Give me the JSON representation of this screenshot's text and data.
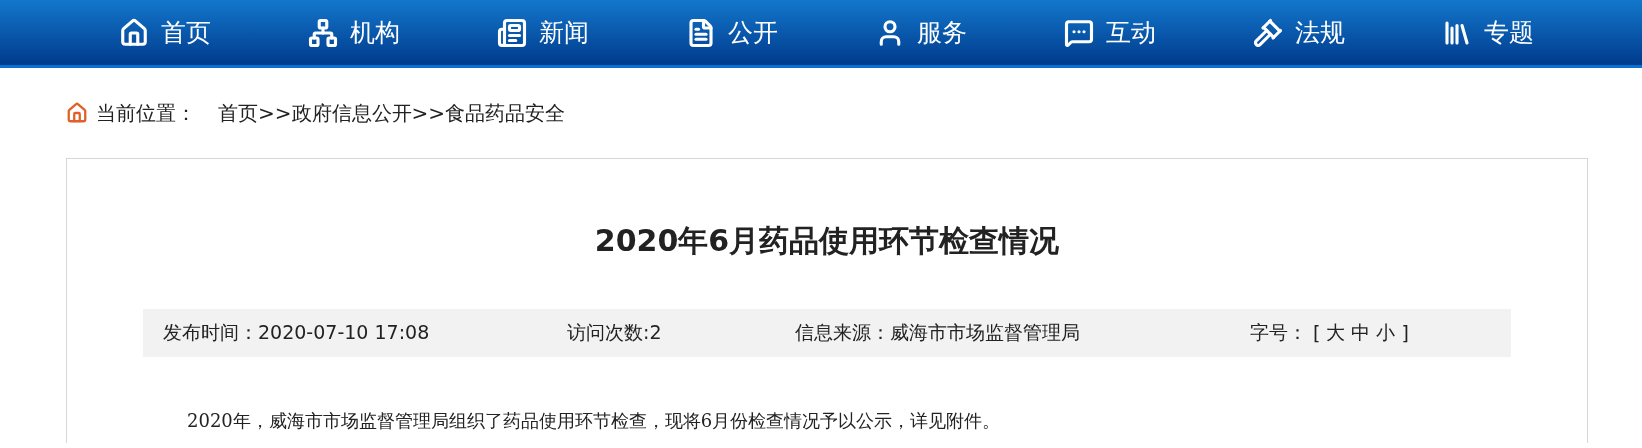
{
  "nav": [
    {
      "label": "首页"
    },
    {
      "label": "机构"
    },
    {
      "label": "新闻"
    },
    {
      "label": "公开"
    },
    {
      "label": "服务"
    },
    {
      "label": "互动"
    },
    {
      "label": "法规"
    },
    {
      "label": "专题"
    }
  ],
  "breadcrumb": {
    "label": "当前位置：",
    "items": [
      "首页",
      ">>",
      "政府信息公开",
      ">>",
      "食品药品安全"
    ]
  },
  "article": {
    "title": "2020年6月药品使用环节检查情况",
    "meta": {
      "published": "发布时间：2020-07-10 17:08",
      "visits": "访问次数:2",
      "source": "信息来源：威海市市场监督管理局",
      "font_size_label": "字号：",
      "font_size_options": [
        "[",
        "大",
        "中",
        "小",
        "]"
      ]
    },
    "body": "2020年，威海市市场监督管理局组织了药品使用环节检查，现将6月份检查情况予以公示，详见附件。"
  }
}
